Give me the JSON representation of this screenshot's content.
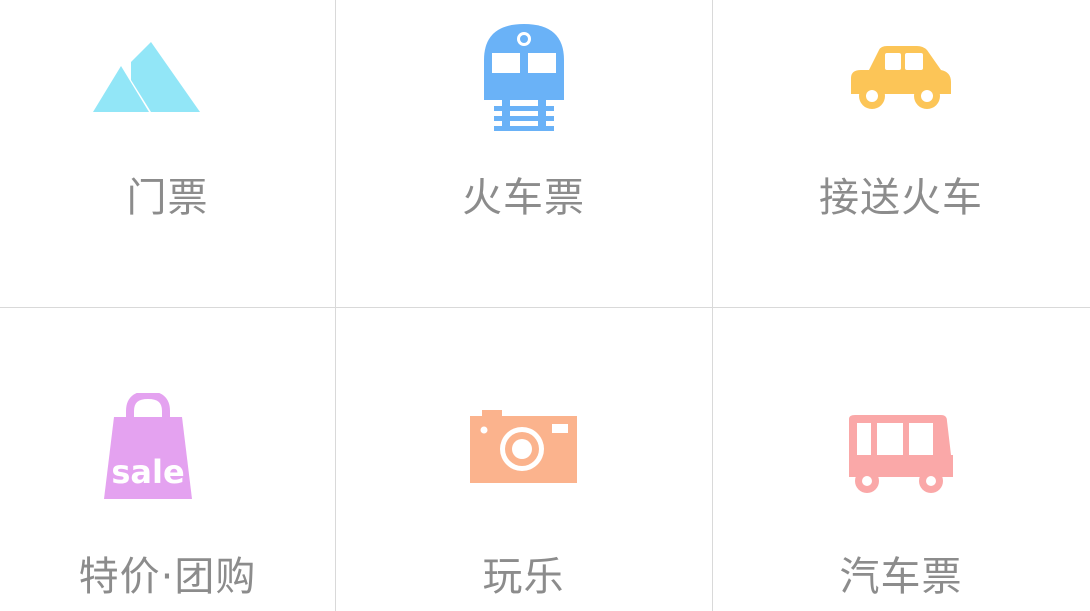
{
  "tiles": [
    {
      "label": "门票",
      "icon": "mountain-icon",
      "color": "#92E6F7"
    },
    {
      "label": "火车票",
      "icon": "train-icon",
      "color": "#6AB2F7"
    },
    {
      "label": "接送火车",
      "icon": "car-icon",
      "color": "#FCC557"
    },
    {
      "label": "特价·团购",
      "icon": "sale-bag-icon",
      "color": "#E4A2F0",
      "icon_text": "sale"
    },
    {
      "label": "玩乐",
      "icon": "camera-icon",
      "color": "#FBB38D"
    },
    {
      "label": "汽车票",
      "icon": "bus-icon",
      "color": "#FAA8A8"
    }
  ]
}
